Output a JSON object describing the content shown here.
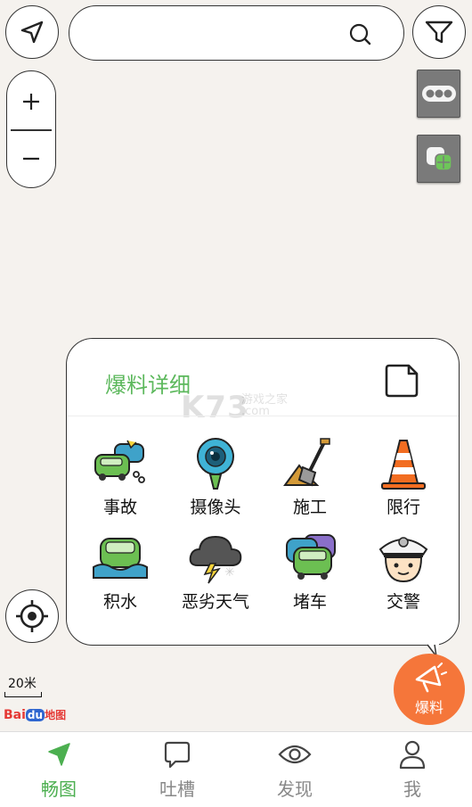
{
  "search": {
    "placeholder": ""
  },
  "popup": {
    "title": "爆料详细",
    "watermark": {
      "brand": "K73",
      "site_cn": "游戏之家",
      "domain": ".com"
    },
    "items": [
      {
        "label": "事故",
        "icon": "car-accident-icon"
      },
      {
        "label": "摄像头",
        "icon": "camera-icon"
      },
      {
        "label": "施工",
        "icon": "construction-shovel-icon"
      },
      {
        "label": "限行",
        "icon": "traffic-cone-icon"
      },
      {
        "label": "积水",
        "icon": "car-flood-icon"
      },
      {
        "label": "恶劣天气",
        "icon": "storm-cloud-icon"
      },
      {
        "label": "堵车",
        "icon": "traffic-jam-icon"
      },
      {
        "label": "交警",
        "icon": "traffic-police-icon"
      }
    ]
  },
  "fab": {
    "label": "爆料"
  },
  "map": {
    "scale": "20米",
    "logo_bai": "Bai",
    "logo_du": "du",
    "logo_map": "地图"
  },
  "tabs": [
    {
      "label": "畅图",
      "active": true
    },
    {
      "label": "吐槽",
      "active": false
    },
    {
      "label": "发现",
      "active": false
    },
    {
      "label": "我",
      "active": false
    }
  ],
  "colors": {
    "accent_green": "#4caf50",
    "title_green": "#5cb85c",
    "fab_orange": "#f5763a"
  }
}
